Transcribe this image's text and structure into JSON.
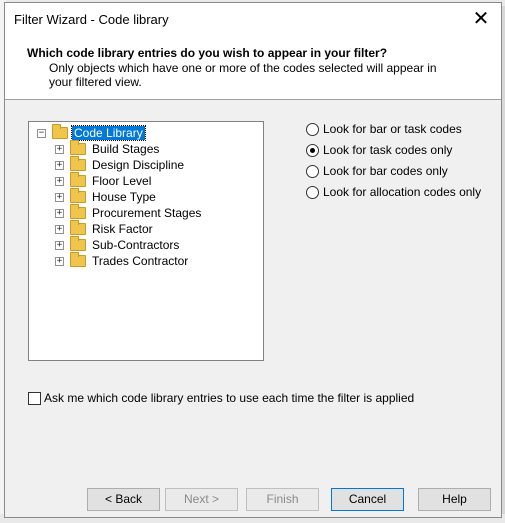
{
  "dialog": {
    "title": "Filter Wizard - Code library",
    "header": {
      "question": "Which code library entries do you wish to appear in your filter?",
      "subtitle": "Only objects which have one or more of the codes selected will appear in your filtered view."
    },
    "tree": {
      "root": "Code Library",
      "children": [
        "Build Stages",
        "Design Discipline",
        "Floor Level",
        "House Type",
        "Procurement Stages",
        "Risk Factor",
        "Sub-Contractors",
        "Trades Contractor"
      ]
    },
    "radios": [
      {
        "label": "Look for bar or task codes",
        "checked": false
      },
      {
        "label": "Look for task codes only",
        "checked": true
      },
      {
        "label": "Look for bar codes only",
        "checked": false
      },
      {
        "label": "Look for allocation codes only",
        "checked": false
      }
    ],
    "checkbox": {
      "label": "Ask me which code library entries to use each time the filter is applied",
      "checked": false
    },
    "buttons": {
      "back": "< Back",
      "next": "Next >",
      "finish": "Finish",
      "cancel": "Cancel",
      "help": "Help"
    }
  }
}
